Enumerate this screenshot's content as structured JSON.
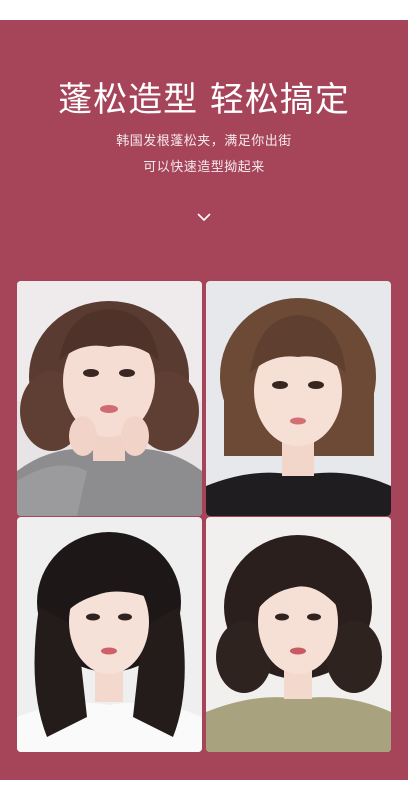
{
  "header": {
    "title": "蓬松造型 轻松搞定",
    "subtitle_line1": "韩国发根蓬松夹，满足你出街",
    "subtitle_line2": "可以快速造型拗起来"
  },
  "icons": {
    "scroll_down": "chevron-down-icon"
  },
  "colors": {
    "background": "#a6455a",
    "text": "#ffffff"
  }
}
